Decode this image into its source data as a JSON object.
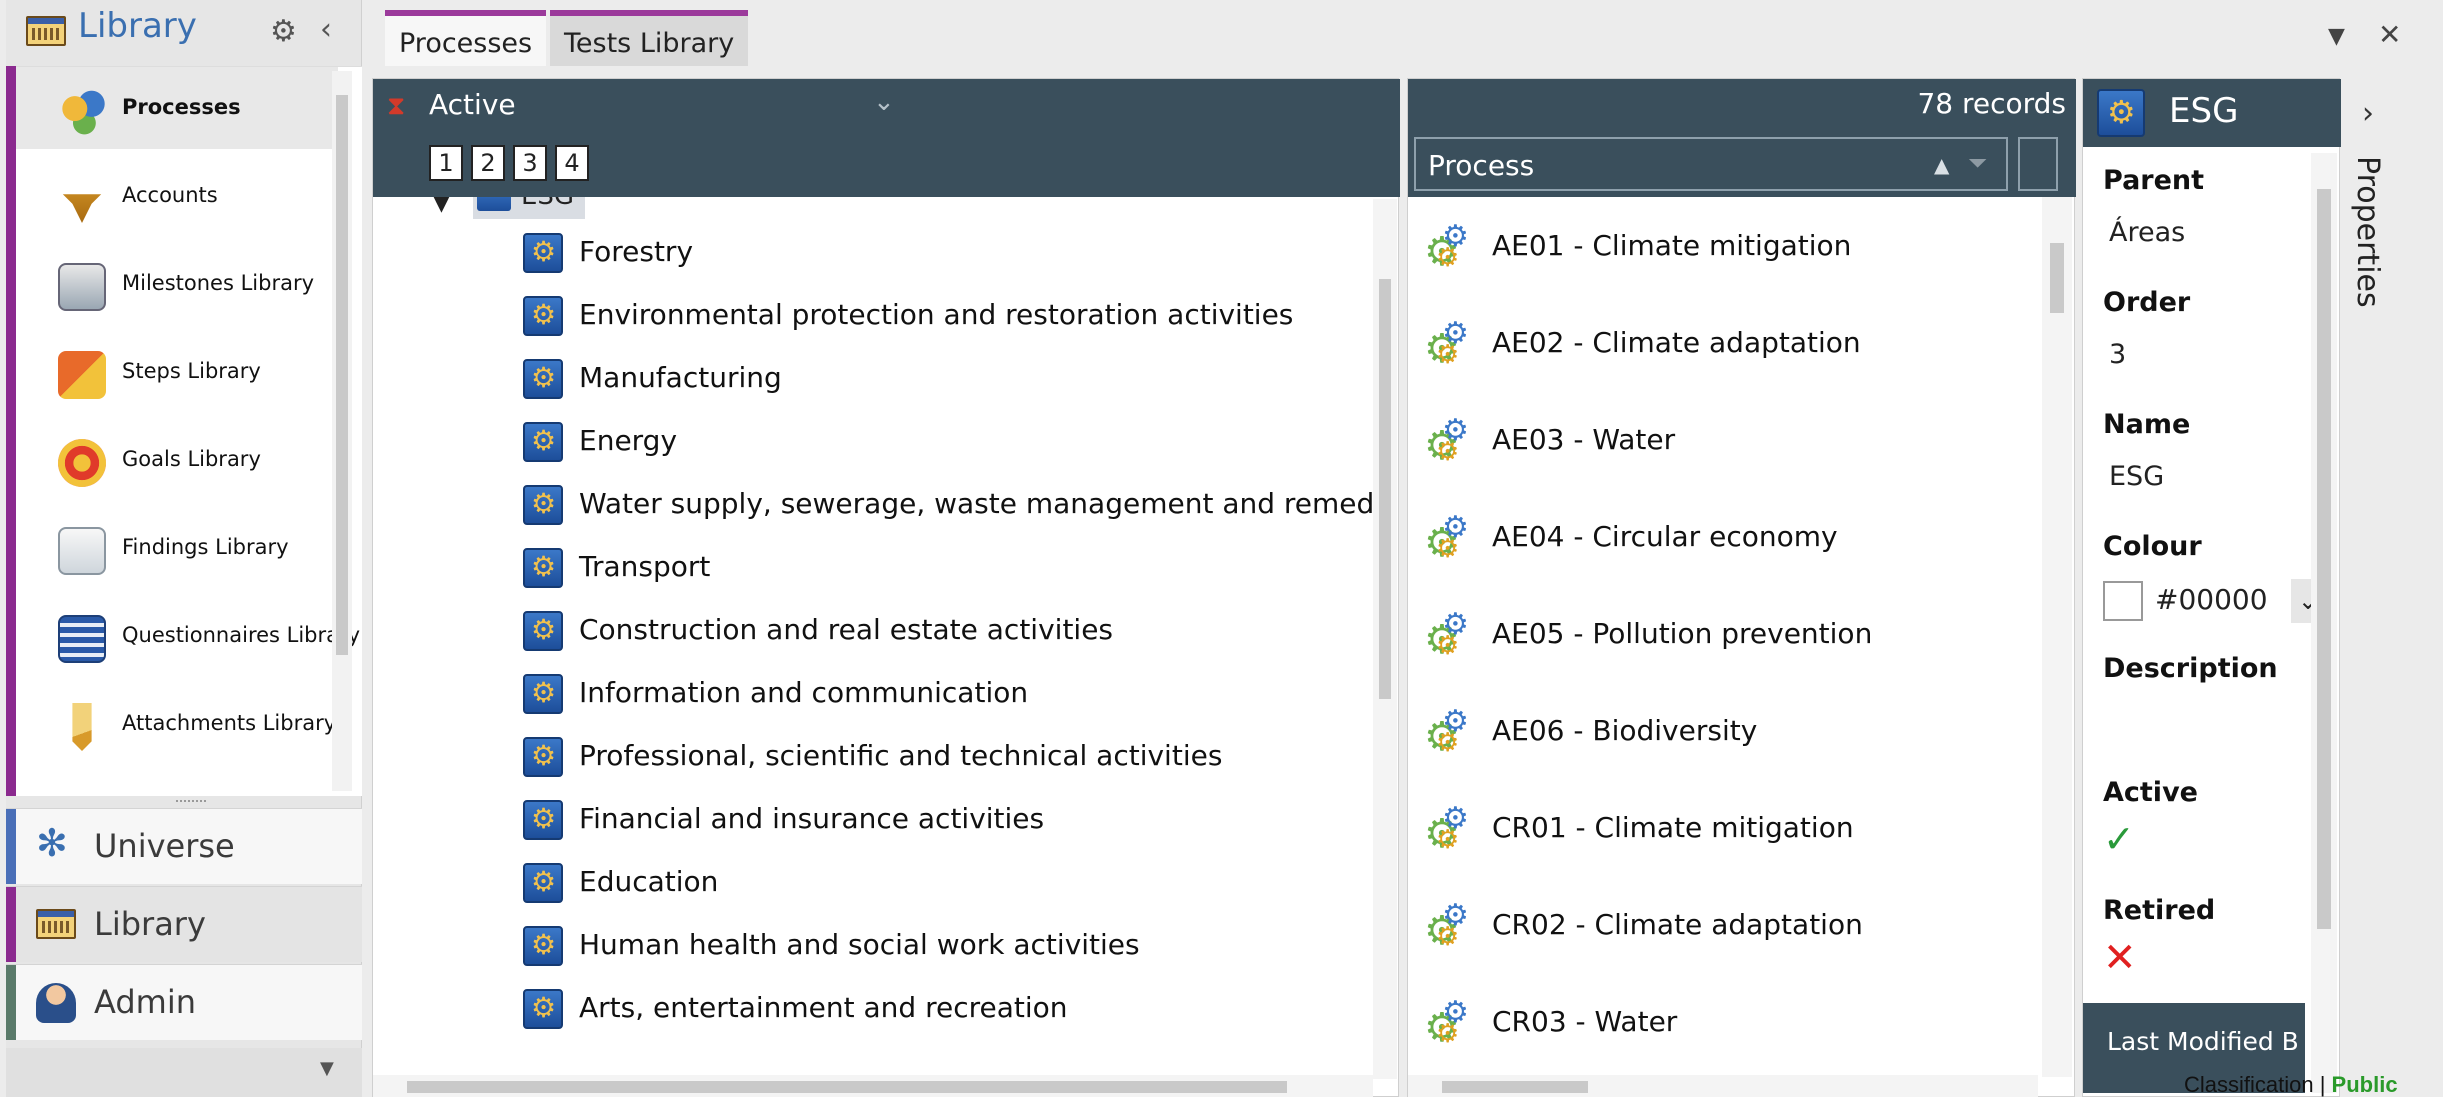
{
  "nav": {
    "title": "Library",
    "items": [
      {
        "label": "Processes"
      },
      {
        "label": "Accounts"
      },
      {
        "label": "Milestones Library"
      },
      {
        "label": "Steps Library"
      },
      {
        "label": "Goals Library"
      },
      {
        "label": "Findings Library"
      },
      {
        "label": "Questionnaires Library"
      },
      {
        "label": "Attachments Library"
      }
    ],
    "sections": [
      {
        "label": "Universe",
        "color": "#4a6fb8"
      },
      {
        "label": "Library",
        "color": "#8b2a8f"
      },
      {
        "label": "Admin",
        "color": "#5a7a6a"
      }
    ]
  },
  "tabs": [
    {
      "label": "Processes"
    },
    {
      "label": "Tests Library"
    }
  ],
  "tree": {
    "filter_label": "Active",
    "pages": [
      "1",
      "2",
      "3",
      "4"
    ],
    "root_label": "ESG",
    "nodes": [
      "Forestry",
      "Environmental protection and restoration activities",
      "Manufacturing",
      "Energy",
      "Water supply, sewerage, waste management and remediation",
      "Transport",
      "Construction and real estate activities",
      "Information and communication",
      "Professional, scientific and technical activities",
      "Financial and insurance activities",
      "Education",
      "Human health and social work activities",
      "Arts, entertainment and recreation"
    ]
  },
  "grid": {
    "record_count": "78 records",
    "column_header": "Process",
    "rows": [
      "AE01 - Climate mitigation",
      "AE02 - Climate adaptation",
      "AE03 - Water",
      "AE04 - Circular economy",
      "AE05 - Pollution prevention",
      "AE06 - Biodiversity",
      "CR01 - Climate mitigation",
      "CR02 - Climate adaptation",
      "CR03 - Water"
    ]
  },
  "properties": {
    "title": "ESG",
    "parent_label": "Parent",
    "parent_value": "Áreas",
    "order_label": "Order",
    "order_value": "3",
    "name_label": "Name",
    "name_value": "ESG",
    "colour_label": "Colour",
    "colour_value": "#00000",
    "description_label": "Description",
    "active_label": "Active",
    "retired_label": "Retired",
    "last_modified_label": "Last Modified B"
  },
  "right_pane": {
    "label": "Properties"
  },
  "classification": {
    "label": "Classification | ",
    "value": "Public"
  },
  "colors": {
    "accent": "#8b2a8f",
    "header_bg": "#3a4f5c",
    "check": "#2a9a3a",
    "cross": "#e02020"
  }
}
